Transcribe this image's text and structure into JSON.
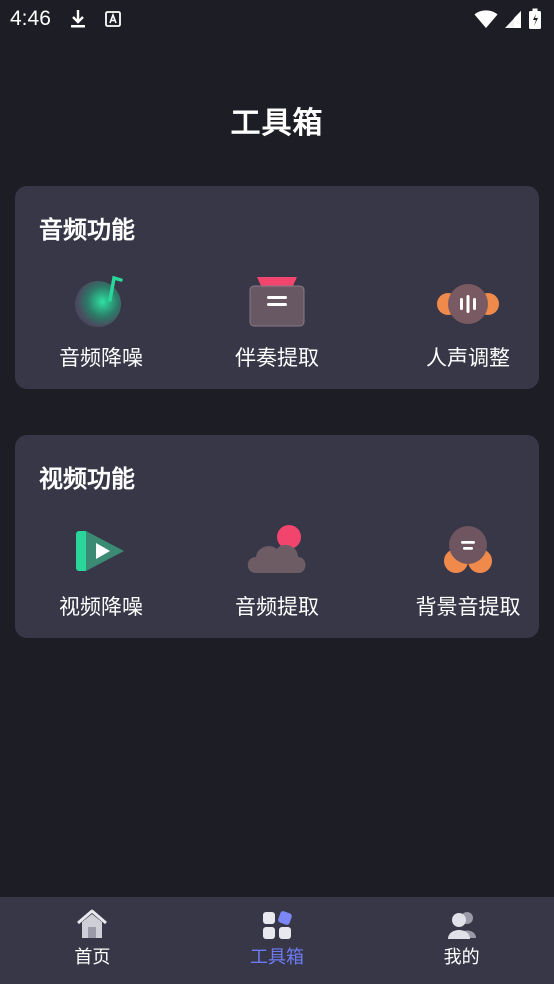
{
  "status_bar": {
    "time": "4:46"
  },
  "page": {
    "title": "工具箱"
  },
  "audio_section": {
    "title": "音频功能",
    "tools": [
      {
        "label": "音频降噪",
        "icon": "audio-denoise-icon"
      },
      {
        "label": "伴奏提取",
        "icon": "accompaniment-extract-icon"
      },
      {
        "label": "人声调整",
        "icon": "vocal-adjust-icon"
      }
    ]
  },
  "video_section": {
    "title": "视频功能",
    "tools": [
      {
        "label": "视频降噪",
        "icon": "video-denoise-icon"
      },
      {
        "label": "音频提取",
        "icon": "audio-extract-icon"
      },
      {
        "label": "背景音提取",
        "icon": "background-sound-extract-icon"
      }
    ]
  },
  "tab_bar": {
    "tabs": [
      {
        "label": "首页",
        "icon": "home-icon",
        "active": false
      },
      {
        "label": "工具箱",
        "icon": "toolbox-icon",
        "active": true
      },
      {
        "label": "我的",
        "icon": "profile-icon",
        "active": false
      }
    ]
  },
  "colors": {
    "background": "#1d1d26",
    "card": "#373748",
    "accent": "#6d7bf2",
    "green": "#2ad69a",
    "pink": "#f2456e",
    "orange": "#f08a4b"
  }
}
